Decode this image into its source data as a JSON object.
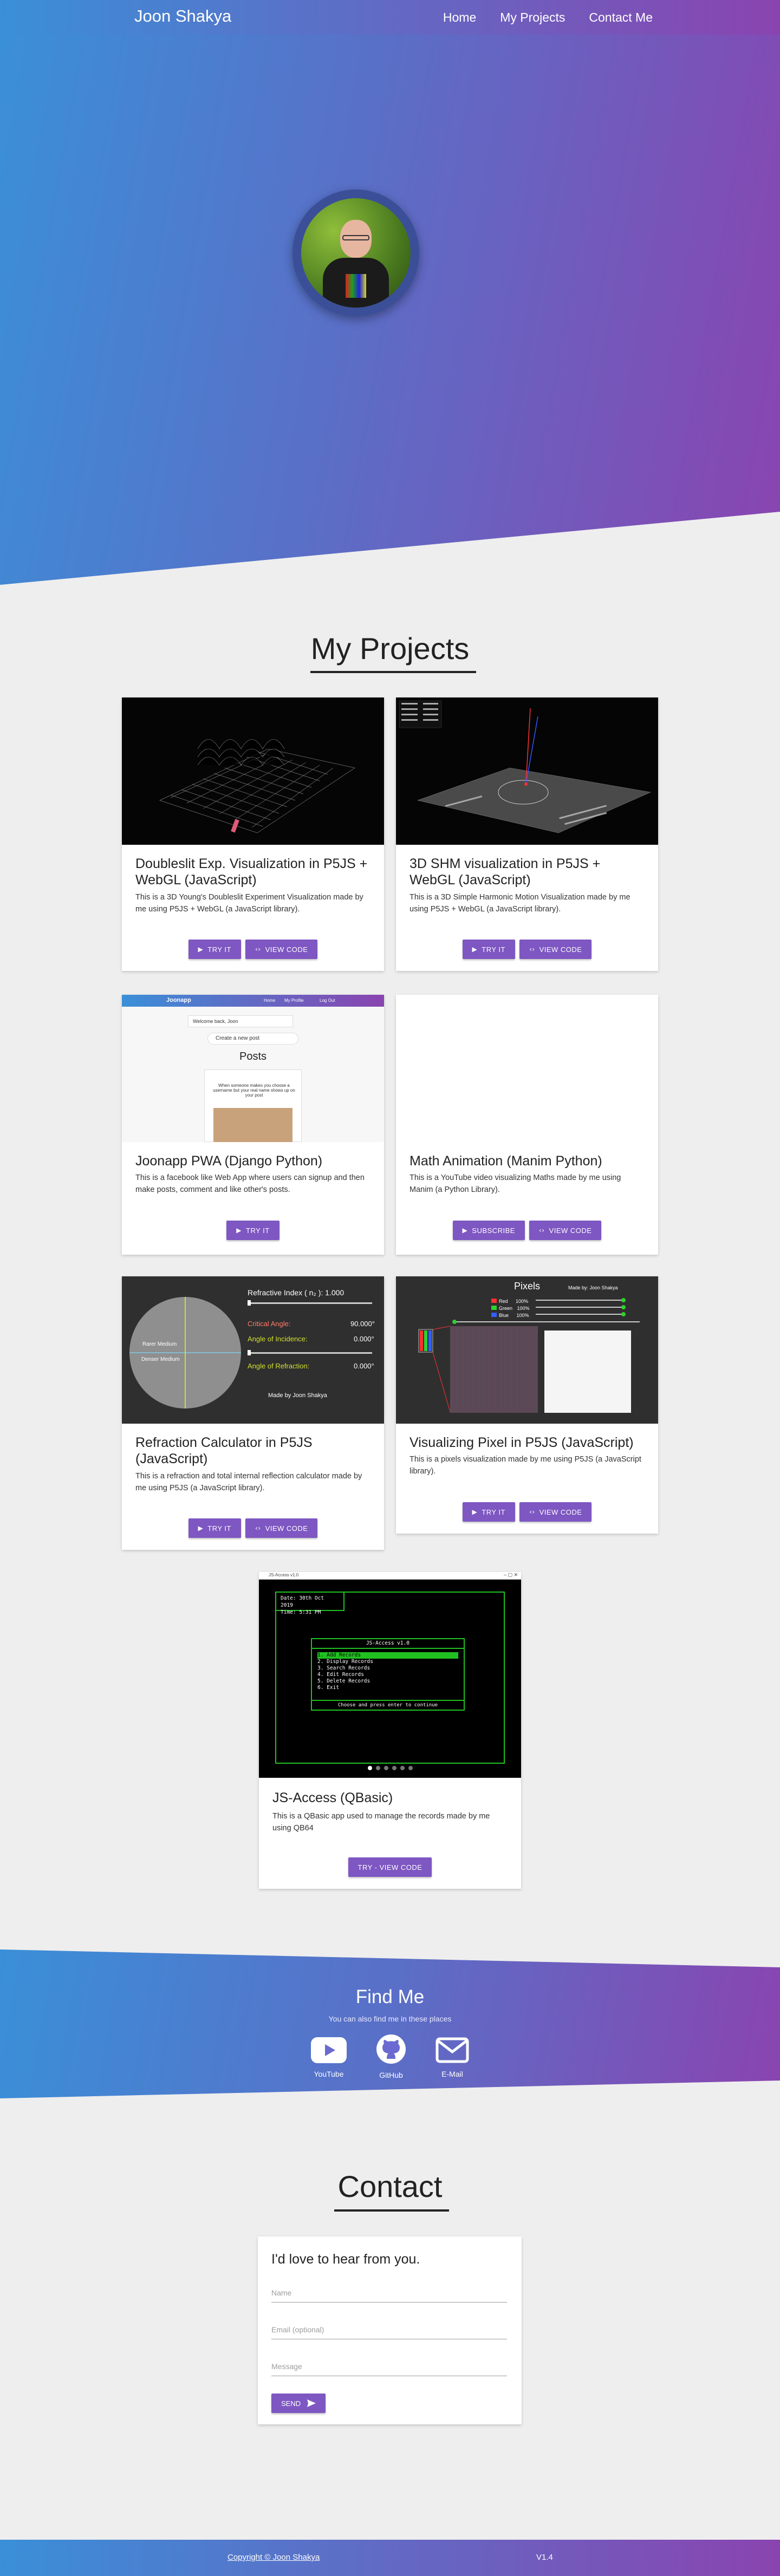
{
  "nav": {
    "brand": "Joon Shakya",
    "links": [
      "Home",
      "My Projects",
      "Contact Me"
    ]
  },
  "projects": {
    "title": "My Projects",
    "cards": [
      {
        "title": "Doubleslit Exp. Visualization in P5JS + WebGL (JavaScript)",
        "desc": "This is a 3D Young's Doubleslit Experiment Visualization made by me using P5JS + WebGL (a JavaScript library).",
        "buttons": [
          "TRY IT",
          "VIEW CODE"
        ]
      },
      {
        "title": "3D SHM visualization in P5JS + WebGL (JavaScript)",
        "desc": "This is a 3D Simple Harmonic Motion Visualization made by me using P5JS + WebGL (a JavaScript library).",
        "buttons": [
          "TRY IT",
          "VIEW CODE"
        ]
      },
      {
        "title": "Joonapp PWA (Django Python)",
        "desc": "This is a facebook like Web App where users can signup and then make posts, comment and like other's posts.",
        "buttons": [
          "TRY IT"
        ],
        "screenshot": {
          "brand": "Joonapp",
          "menu": [
            "Home",
            "My Profile",
            "Log Out"
          ],
          "welcome": "Welcome back, Joon",
          "new_post": "Create a new post",
          "posts_heading": "Posts",
          "post_text": "When someone makes you choose a username but your real name shows up on your post"
        }
      },
      {
        "title": "Math Animation (Manim Python)",
        "desc": "This is a YouTube video visualizing Maths made by me using Manim (a Python Library).",
        "buttons": [
          "SUBSCRIBE",
          "VIEW CODE"
        ]
      },
      {
        "title": "Refraction Calculator in P5JS (JavaScript)",
        "desc": "This is a refraction and total internal reflection calculator made by me using P5JS (a JavaScript library).",
        "buttons": [
          "TRY IT",
          "VIEW CODE"
        ],
        "screenshot": {
          "refractive_label": "Refractive Index ( n₂ ): 1.000",
          "critical_label": "Critical Angle:",
          "critical_value": "90.000°",
          "incidence_label": "Angle of Incidence:",
          "incidence_value": "0.000°",
          "refraction_label": "Angle of Refraction:",
          "refraction_value": "0.000°",
          "rarer": "Rarer Medium",
          "denser": "Denser Medium",
          "credit": "Made by Joon Shakya"
        }
      },
      {
        "title": "Visualizing Pixel in P5JS (JavaScript)",
        "desc": "This is a pixels visualization made by me using P5JS (a JavaScript library).",
        "buttons": [
          "TRY IT",
          "VIEW CODE"
        ],
        "screenshot": {
          "heading": "Pixels",
          "credit": "Made by: Joon Shakya",
          "channels": [
            {
              "name": "Red",
              "value": "100%",
              "color": "#ff3030"
            },
            {
              "name": "Green",
              "value": "100%",
              "color": "#30d030"
            },
            {
              "name": "Blue",
              "value": "100%",
              "color": "#3060ff"
            }
          ]
        }
      },
      {
        "title": "JS-Access (QBasic)",
        "desc": "This is a QBasic app used to manage the records made by me using QB64",
        "buttons": [
          "TRY - VIEW CODE"
        ],
        "screenshot": {
          "window_title": "JS-Access v1.0",
          "date": "Date: 30th Oct 2019",
          "time": "Time: 5:31 PM",
          "menu_title": "JS-Access v1.0",
          "menu_items": [
            "1.  Add Records",
            "2.  Display Records",
            "3.  Search Records",
            "4.  Edit Records",
            "5.  Delete Records",
            "6.  Exit"
          ],
          "prompt": "Choose and press enter to continue"
        }
      }
    ]
  },
  "findme": {
    "title": "Find Me",
    "subtitle": "You can also find me in these places",
    "links": [
      {
        "label": "YouTube",
        "icon": "youtube-icon"
      },
      {
        "label": "GitHub",
        "icon": "github-icon"
      },
      {
        "label": "E-Mail",
        "icon": "email-icon"
      }
    ]
  },
  "contact": {
    "title": "Contact",
    "heading": "I'd love to hear from you.",
    "name_placeholder": "Name",
    "email_placeholder": "Email (optional)",
    "message_placeholder": "Message",
    "send_label": "SEND"
  },
  "footer": {
    "copyright": "Copyright © Joon Shakya",
    "version": "V1.4"
  },
  "colors": {
    "gradient_start": "#3a8fd8",
    "gradient_end": "#8a44b0",
    "button": "#7e57c2"
  }
}
